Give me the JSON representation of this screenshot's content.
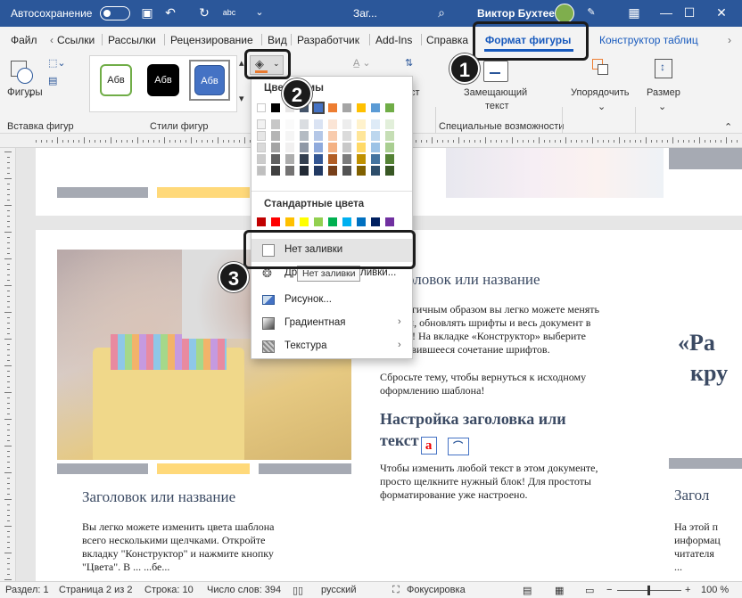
{
  "titlebar": {
    "autosave": "Автосохранение",
    "doc": "Заг...",
    "user": "Виктор Бухтеев"
  },
  "menu": {
    "file": "Файл",
    "links": "Ссылки",
    "mailings": "Рассылки",
    "review": "Рецензирование",
    "view": "Вид",
    "developer": "Разработчик",
    "addins": "Add-Ins",
    "help": "Справка",
    "shape_format": "Формат фигуры",
    "table_design": "Конструктор таблиц"
  },
  "ribbon": {
    "shapes": "Фигуры",
    "insert_shapes": "Вставка фигур",
    "shape_styles": "Стили фигур",
    "style_sample": "Абв",
    "text_suffix": "ст",
    "alt_text_line1": "Замещающий",
    "alt_text_line2": "текст",
    "accessibility": "Специальные возможности",
    "arrange": "Упорядочить",
    "size": "Размер"
  },
  "dropdown": {
    "theme_colors": "Цвета темы",
    "standard_colors": "Стандартные цвета",
    "no_fill": "Нет заливки",
    "other_colors": "Другие цвета заливки...",
    "picture": "Рисунок...",
    "gradient": "Градиентная",
    "texture": "Текстура",
    "tooltip": "Нет заливки",
    "theme_row": [
      "#ffffff",
      "#000000",
      "#e7e6e6",
      "#44546a",
      "#4472c4",
      "#ed7d31",
      "#a5a5a5",
      "#ffc000",
      "#5b9bd5",
      "#70ad47"
    ],
    "standard_row": [
      "#c00000",
      "#ff0000",
      "#ffc000",
      "#ffff00",
      "#92d050",
      "#00b050",
      "#00b0f0",
      "#0070c0",
      "#002060",
      "#7030a0"
    ]
  },
  "document": {
    "heading1": "Заголовок или название",
    "heading1_partial": "оловок или название",
    "p1_lines": [
      "огичным образом вы легко можете менять",
      "ы, обновлять шрифты и весь документ в",
      "л! На вкладке «Конструктор» выберите",
      "авившееся сочетание шрифтов."
    ],
    "p2_lines": [
      "Сбросьте тему, чтобы вернуться к исходному",
      "оформлению шаблона!"
    ],
    "heading2_line1": "Настройка заголовка или",
    "heading2_line2": "текст",
    "p3_lines": [
      "Чтобы изменить любой текст в этом документе,",
      "просто щелкните нужный блок! Для простоты",
      "форматирование уже настроено."
    ],
    "left_heading": "Заголовок или название",
    "left_p_lines": [
      "Вы легко можете изменить цвета шаблона",
      "всего несколькими щелчками. Откройте",
      "вкладку \"Конструктор\" и нажмите кнопку",
      "\"Цвета\". В ... ...бе..."
    ],
    "right_quote": "«Ра",
    "right_quote2": "кру",
    "right_heading": "Загол",
    "right_p_lines": [
      "На этой п",
      "информац",
      "читателя",
      "..."
    ]
  },
  "status": {
    "section": "Раздел: 1",
    "page": "Страница 2 из 2",
    "line": "Строка: 10",
    "words": "Число слов: 394",
    "lang": "русский",
    "focus": "Фокусировка",
    "zoom": "100 %"
  },
  "badges": {
    "b1": "1",
    "b2": "2",
    "b3": "3"
  },
  "colors": {
    "accent": "#2b579a",
    "gray_bar": "#a6aab3",
    "yellow_bar": "#ffd97a",
    "heading": "#3b4a63",
    "active_tab": "#185abd"
  }
}
